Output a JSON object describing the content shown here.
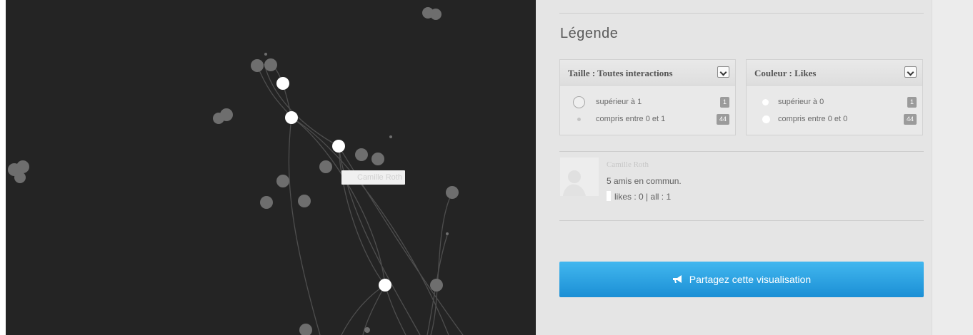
{
  "graph": {
    "hover_label": "Camille Roth"
  },
  "legend": {
    "title": "Légende",
    "size_box": {
      "title": "Taille : Toutes interactions",
      "rows": [
        {
          "label": "supérieur à 1",
          "count": "1"
        },
        {
          "label": "compris entre 0 et 1",
          "count": "44"
        }
      ]
    },
    "color_box": {
      "title": "Couleur : Likes",
      "rows": [
        {
          "label": "supérieur à 0",
          "count": "1"
        },
        {
          "label": "compris entre 0 et 0",
          "count": "44"
        }
      ]
    }
  },
  "person": {
    "name": "Camille Roth",
    "mutual_friends": "5 amis en commun.",
    "stats": "likes : 0 | all : 1"
  },
  "share": {
    "label": "Partagez cette visualisation",
    "icon": "megaphone-icon"
  },
  "colors": {
    "graph_bg": "#242424",
    "node_highlight": "#ffffff",
    "node_default": "#6e6e6e",
    "share_button": "#2aa3e4"
  }
}
